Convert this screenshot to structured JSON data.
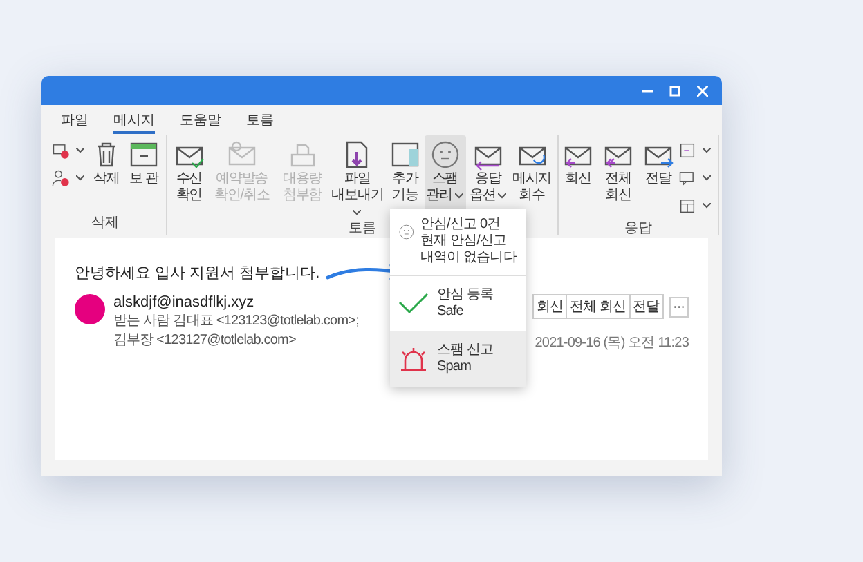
{
  "tabs": [
    {
      "label": "파일",
      "selected": false
    },
    {
      "label": "메시지",
      "selected": true
    },
    {
      "label": "도움말",
      "selected": false
    },
    {
      "label": "토름",
      "selected": false
    }
  ],
  "ribbon": {
    "groups": [
      {
        "label": "삭제",
        "items": [
          {
            "kind": "smallstack"
          },
          {
            "kind": "large",
            "label": "삭제",
            "disabled": false,
            "dropdown": false,
            "pressed": false
          },
          {
            "kind": "large",
            "label": "보 관",
            "disabled": false,
            "dropdown": false,
            "pressed": false
          }
        ]
      },
      {
        "label": "토름",
        "items": [
          {
            "kind": "large",
            "label": "수신 확인",
            "disabled": false,
            "dropdown": false,
            "pressed": false
          },
          {
            "kind": "large",
            "label": "예약발송 확인/취소",
            "disabled": true,
            "dropdown": false,
            "pressed": false
          },
          {
            "kind": "large",
            "label": "대용량 첨부함",
            "disabled": true,
            "dropdown": false,
            "pressed": false
          },
          {
            "kind": "large",
            "label": "파일 내보내기",
            "disabled": false,
            "dropdown": true,
            "pressed": false
          },
          {
            "kind": "large",
            "label": "추가 기능",
            "disabled": false,
            "dropdown": false,
            "pressed": false
          },
          {
            "kind": "large",
            "label": "스팸 관리",
            "disabled": false,
            "dropdown": true,
            "pressed": true
          },
          {
            "kind": "large",
            "label": "응답 옵션",
            "disabled": false,
            "dropdown": true,
            "pressed": false
          },
          {
            "kind": "large",
            "label": "메시지 회수",
            "disabled": false,
            "dropdown": false,
            "pressed": false
          }
        ]
      },
      {
        "label": "응답",
        "items": [
          {
            "kind": "large",
            "label": "회신",
            "disabled": false,
            "dropdown": false,
            "pressed": false
          },
          {
            "kind": "large",
            "label": "전체 회신",
            "disabled": false,
            "dropdown": false,
            "pressed": false
          },
          {
            "kind": "large",
            "label": "전달",
            "disabled": false,
            "dropdown": false,
            "pressed": false
          },
          {
            "kind": "smallstack"
          }
        ]
      }
    ]
  },
  "spam_menu": {
    "title": "안심/신고 0건",
    "message": "현재 안심/신고 내역이 없습니다",
    "items": [
      {
        "label": "안심 등록",
        "sublabel": "Safe",
        "selected": false
      },
      {
        "label": "스팸 신고",
        "sublabel": "Spam",
        "selected": true
      }
    ]
  },
  "message": {
    "subject": "안녕하세요 입사 지원서 첨부합니다.",
    "sender": "alskdjf@inasdflkj.xyz",
    "to_label": "받는 사람",
    "recipients": "김대표 <123123@totlelab.com>; 김부장 <123127@totlelab.com>",
    "actions": [
      "회신",
      "전체 회신",
      "전달"
    ],
    "more": "···",
    "date": "2021-09-16 (목) 오전 11:23"
  }
}
